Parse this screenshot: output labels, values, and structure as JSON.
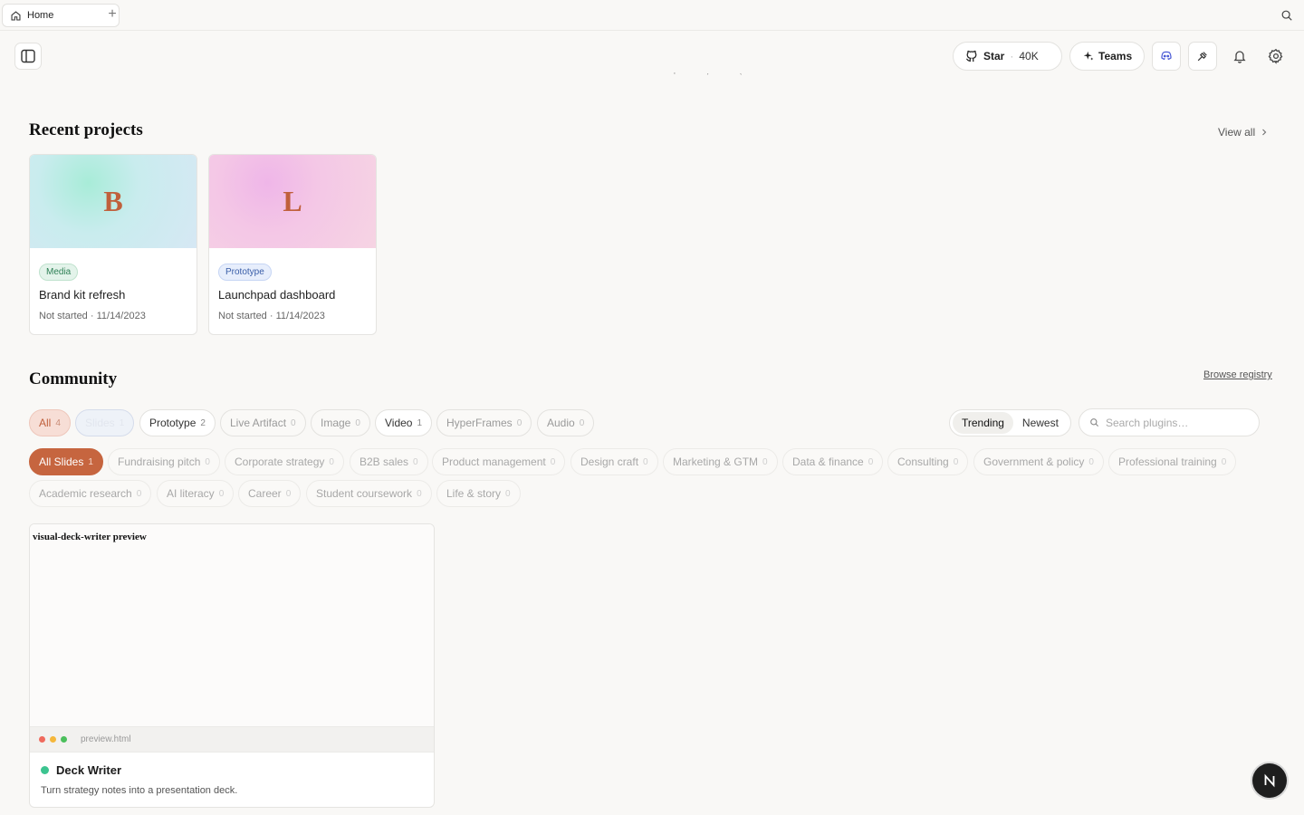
{
  "tabs": [
    {
      "label": "Home"
    }
  ],
  "header": {
    "star_label": "Star",
    "star_count": "40K",
    "teams_label": "Teams"
  },
  "recent": {
    "title": "Recent projects",
    "view_all": "View all",
    "projects": [
      {
        "initial": "B",
        "tag": "Media",
        "name": "Brand kit refresh",
        "status": "Not started",
        "date": "11/14/2023"
      },
      {
        "initial": "L",
        "tag": "Prototype",
        "name": "Launchpad dashboard",
        "status": "Not started",
        "date": "11/14/2023"
      }
    ]
  },
  "community": {
    "title": "Community",
    "browse": "Browse registry",
    "type_filters": [
      {
        "label": "All",
        "count": "4"
      },
      {
        "label": "Slides",
        "count": "1"
      },
      {
        "label": "Prototype",
        "count": "2"
      },
      {
        "label": "Live Artifact",
        "count": "0"
      },
      {
        "label": "Image",
        "count": "0"
      },
      {
        "label": "Video",
        "count": "1"
      },
      {
        "label": "HyperFrames",
        "count": "0"
      },
      {
        "label": "Audio",
        "count": "0"
      }
    ],
    "sort": {
      "trending": "Trending",
      "newest": "Newest"
    },
    "search_placeholder": "Search plugins…",
    "category_filters": [
      {
        "label": "All Slides",
        "count": "1"
      },
      {
        "label": "Fundraising pitch",
        "count": "0"
      },
      {
        "label": "Corporate strategy",
        "count": "0"
      },
      {
        "label": "B2B sales",
        "count": "0"
      },
      {
        "label": "Product management",
        "count": "0"
      },
      {
        "label": "Design craft",
        "count": "0"
      },
      {
        "label": "Marketing & GTM",
        "count": "0"
      },
      {
        "label": "Data & finance",
        "count": "0"
      },
      {
        "label": "Consulting",
        "count": "0"
      },
      {
        "label": "Government & policy",
        "count": "0"
      },
      {
        "label": "Professional training",
        "count": "0"
      },
      {
        "label": "Academic research",
        "count": "0"
      },
      {
        "label": "AI literacy",
        "count": "0"
      },
      {
        "label": "Career",
        "count": "0"
      },
      {
        "label": "Student coursework",
        "count": "0"
      },
      {
        "label": "Life & story",
        "count": "0"
      }
    ],
    "plugin": {
      "preview_title": "visual-deck-writer preview",
      "preview_file": "preview.html",
      "name": "Deck Writer",
      "description": "Turn strategy notes into a presentation deck."
    }
  },
  "fab_letter": "N",
  "colors": {
    "accent": "#c6653f",
    "status_ok": "#3cc490"
  }
}
